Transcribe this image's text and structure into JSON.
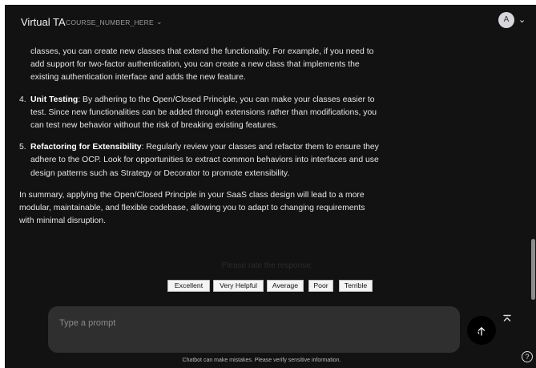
{
  "header": {
    "title": "Virtual TA",
    "course": "COURSE_NUMBER_HERE",
    "course_chevron": "⌄",
    "avatar_letter": "A",
    "avatar_chevron": "⌄"
  },
  "content": {
    "intro_continuation": "classes, you can create new classes that extend the functionality. For example, if you need to add support for two-factor authentication, you can create a new class that implements the existing authentication interface and adds the new feature.",
    "items": [
      {
        "number": "4.",
        "title": "Unit Testing",
        "text": ": By adhering to the Open/Closed Principle, you can make your classes easier to test. Since new functionalities can be added through extensions rather than modifications, you can test new behavior without the risk of breaking existing features."
      },
      {
        "number": "5.",
        "title": "Refactoring for Extensibility",
        "text": ": Regularly review your classes and refactor them to ensure they adhere to the OCP. Look for opportunities to extract common behaviors into interfaces and use design patterns such as Strategy or Decorator to promote extensibility."
      }
    ],
    "summary": "In summary, applying the Open/Closed Principle in your SaaS class design will lead to a more modular, maintainable, and flexible codebase, allowing you to adapt to changing requirements with minimal disruption."
  },
  "rating": {
    "label": "Please rate the response:",
    "options": [
      "Excellent",
      "Very Helpful",
      "Average",
      "Poor",
      "Terrible"
    ]
  },
  "prompt": {
    "placeholder": "Type a prompt",
    "value": ""
  },
  "icons": {
    "send": "send-icon",
    "collapse": "collapse-up-icon",
    "help": "help-icon"
  },
  "disclaimer": "Chatbot can make mistakes. Please verify sensitive information.",
  "colors": {
    "background": "#121212",
    "prompt_box": "#2f2f2f",
    "text": "#e6e6e6",
    "rating_button": "#f4f4f4"
  }
}
